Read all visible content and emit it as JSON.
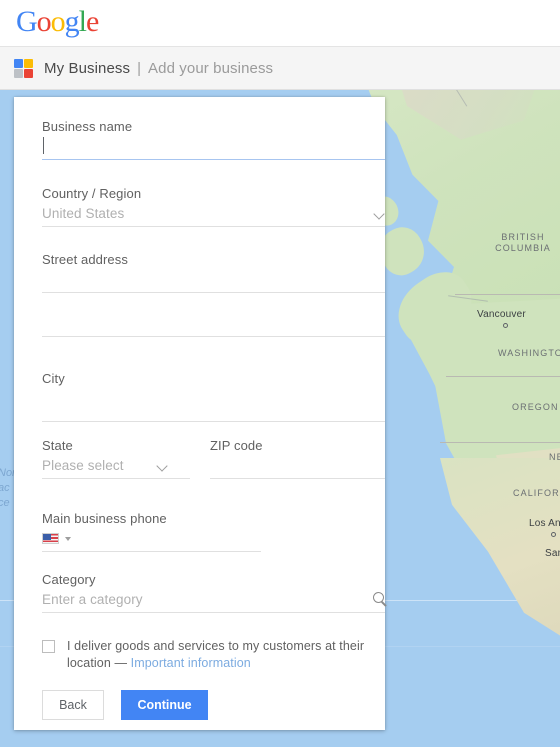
{
  "logo": {
    "letters": [
      {
        "ch": "G",
        "color": "#4285f4"
      },
      {
        "ch": "o",
        "color": "#ea4335"
      },
      {
        "ch": "o",
        "color": "#fbbc05"
      },
      {
        "ch": "g",
        "color": "#4285f4"
      },
      {
        "ch": "l",
        "color": "#34a853"
      },
      {
        "ch": "e",
        "color": "#ea4335"
      }
    ]
  },
  "app_bar": {
    "title": "My Business",
    "separator": "|",
    "subtitle": "Add your business",
    "icon": "my-business-pinwheel-icon"
  },
  "form": {
    "business_name": {
      "label": "Business name",
      "value": "",
      "focused": true
    },
    "country": {
      "label": "Country / Region",
      "value": "United States",
      "caret_icon": "chevron-down-icon"
    },
    "street": {
      "label": "Street address",
      "line1": "",
      "line2": ""
    },
    "city": {
      "label": "City",
      "value": ""
    },
    "state": {
      "label": "State",
      "placeholder": "Please select",
      "caret_icon": "chevron-down-icon"
    },
    "zip": {
      "label": "ZIP code",
      "value": ""
    },
    "phone": {
      "label": "Main business phone",
      "value": "",
      "flag": "us-flag-icon",
      "flag_caret": "caret-down-icon"
    },
    "category": {
      "label": "Category",
      "placeholder": "Enter a category",
      "value": "",
      "icon": "search-icon"
    },
    "deliver": {
      "checked": false,
      "text": "I deliver goods and services to my customers at their location — ",
      "link": "Important information"
    },
    "buttons": {
      "back": "Back",
      "continue": "Continue"
    }
  },
  "map": {
    "regions": [
      {
        "name": "BRITISH COLUMBIA",
        "line1": "BRITISH",
        "line2": "COLUMBIA"
      },
      {
        "name": "WASHINGTON"
      },
      {
        "name": "OREGON"
      },
      {
        "name": "CALIFORNIA"
      },
      {
        "name": "NE"
      }
    ],
    "cities": [
      {
        "name": "Vancouver"
      },
      {
        "name": "Los An"
      },
      {
        "name": "San"
      }
    ],
    "ocean_label": {
      "line1": "Nor",
      "line2": "ac",
      "line3": "ce"
    },
    "colors": {
      "water": "#a5cdf0",
      "land": "#cfe3bd",
      "label": "#6b6f73"
    }
  },
  "theme": {
    "accent": "#4285f4",
    "link": "#7cabe0",
    "underline": "#e0e0e0"
  }
}
